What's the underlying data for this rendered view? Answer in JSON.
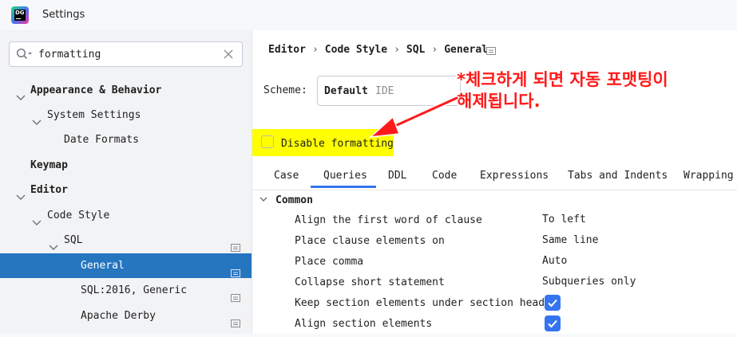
{
  "window": {
    "title": "Settings",
    "app_icon": "datagrip-app-icon",
    "app_icon_text": "DG"
  },
  "search": {
    "value": "formatting",
    "clear_icon": "close-icon"
  },
  "tree": [
    {
      "label": "Appearance & Behavior",
      "expanded": true,
      "bold": true
    },
    {
      "label": "System Settings",
      "expanded": true
    },
    {
      "label": "Date Formats"
    },
    {
      "label": "Keymap",
      "bold": true
    },
    {
      "label": "Editor",
      "expanded": true,
      "bold": true
    },
    {
      "label": "Code Style",
      "expanded": true
    },
    {
      "label": "SQL",
      "expanded": true,
      "project_icon": true
    },
    {
      "label": "General",
      "selected": true,
      "project_icon": true
    },
    {
      "label": "SQL:2016, Generic",
      "project_icon": true
    },
    {
      "label": "Apache Derby",
      "project_icon": true
    }
  ],
  "breadcrumb": [
    "Editor",
    "Code Style",
    "SQL",
    "General"
  ],
  "scheme": {
    "label": "Scheme:",
    "value": "Default",
    "sub": "IDE"
  },
  "disable_formatting": {
    "label": "Disable formatting",
    "checked": false
  },
  "tabs": [
    "Case",
    "Queries",
    "DDL",
    "Code",
    "Expressions",
    "Tabs and Indents",
    "Wrapping"
  ],
  "active_tab": "Queries",
  "section": {
    "label": "Common",
    "expanded": true
  },
  "options": [
    {
      "name": "Align the first word of clause",
      "value": "To left"
    },
    {
      "name": "Place clause elements on",
      "value": "Same line"
    },
    {
      "name": "Place comma",
      "value": "Auto"
    },
    {
      "name": "Collapse short statement",
      "value": "Subqueries only"
    },
    {
      "name": "Keep section elements under section header",
      "checked": true
    },
    {
      "name": "Align section elements",
      "checked": true
    }
  ],
  "annotation": {
    "line1": "*체크하게 되면 자동 포맷팅이",
    "line2": "해제됩니다.",
    "color": "#ff1a1a"
  },
  "colors": {
    "selection": "#2675bf",
    "accent": "#3574f0",
    "highlight": "#ffff00"
  }
}
